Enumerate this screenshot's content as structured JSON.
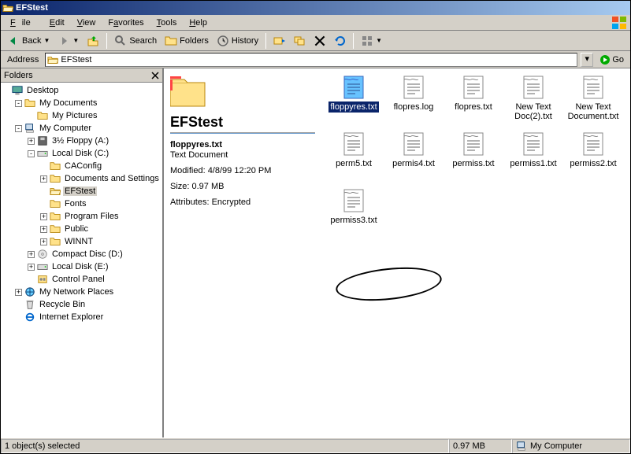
{
  "window": {
    "title": "EFStest"
  },
  "menu": {
    "file": "File",
    "edit": "Edit",
    "view": "View",
    "favorites": "Favorites",
    "tools": "Tools",
    "help": "Help"
  },
  "toolbar": {
    "back": "Back",
    "search": "Search",
    "folders": "Folders",
    "history": "History"
  },
  "address": {
    "label": "Address",
    "value": "EFStest",
    "go": "Go"
  },
  "foldersPane": {
    "title": "Folders"
  },
  "tree": [
    {
      "depth": 0,
      "exp": "",
      "icon": "desktop",
      "label": "Desktop"
    },
    {
      "depth": 1,
      "exp": "-",
      "icon": "folder",
      "label": "My Documents"
    },
    {
      "depth": 2,
      "exp": "",
      "icon": "folder",
      "label": "My Pictures"
    },
    {
      "depth": 1,
      "exp": "-",
      "icon": "computer",
      "label": "My Computer"
    },
    {
      "depth": 2,
      "exp": "+",
      "icon": "floppy",
      "label": "3½ Floppy (A:)"
    },
    {
      "depth": 2,
      "exp": "-",
      "icon": "disk",
      "label": "Local Disk (C:)"
    },
    {
      "depth": 3,
      "exp": "",
      "icon": "folder",
      "label": "CAConfig"
    },
    {
      "depth": 3,
      "exp": "+",
      "icon": "folder",
      "label": "Documents and Settings"
    },
    {
      "depth": 3,
      "exp": "",
      "icon": "folder-open",
      "label": "EFStest",
      "selected": true
    },
    {
      "depth": 3,
      "exp": "",
      "icon": "folder",
      "label": "Fonts"
    },
    {
      "depth": 3,
      "exp": "+",
      "icon": "folder",
      "label": "Program Files"
    },
    {
      "depth": 3,
      "exp": "+",
      "icon": "folder",
      "label": "Public"
    },
    {
      "depth": 3,
      "exp": "+",
      "icon": "folder",
      "label": "WINNT"
    },
    {
      "depth": 2,
      "exp": "+",
      "icon": "cd",
      "label": "Compact Disc (D:)"
    },
    {
      "depth": 2,
      "exp": "+",
      "icon": "disk",
      "label": "Local Disk (E:)"
    },
    {
      "depth": 2,
      "exp": "",
      "icon": "cpl",
      "label": "Control Panel"
    },
    {
      "depth": 1,
      "exp": "+",
      "icon": "network",
      "label": "My Network Places"
    },
    {
      "depth": 1,
      "exp": "",
      "icon": "recycle",
      "label": "Recycle Bin"
    },
    {
      "depth": 1,
      "exp": "",
      "icon": "ie",
      "label": "Internet Explorer"
    }
  ],
  "info": {
    "folderName": "EFStest",
    "fileName": "floppyres.txt",
    "fileType": "Text Document",
    "modified": "Modified: 4/8/99 12:20 PM",
    "size": "Size: 0.97 MB",
    "attributes": "Attributes: Encrypted"
  },
  "files": [
    {
      "name": "floppyres.txt",
      "selected": true
    },
    {
      "name": "flopres.log"
    },
    {
      "name": "flopres.txt"
    },
    {
      "name": "New Text Doc(2).txt"
    },
    {
      "name": "New Text Document.txt"
    },
    {
      "name": "perm5.txt"
    },
    {
      "name": "permis4.txt"
    },
    {
      "name": "permiss.txt"
    },
    {
      "name": "permiss1.txt"
    },
    {
      "name": "permiss2.txt"
    },
    {
      "name": "permiss3.txt"
    }
  ],
  "status": {
    "selection": "1 object(s) selected",
    "size": "0.97 MB",
    "location": "My Computer"
  }
}
